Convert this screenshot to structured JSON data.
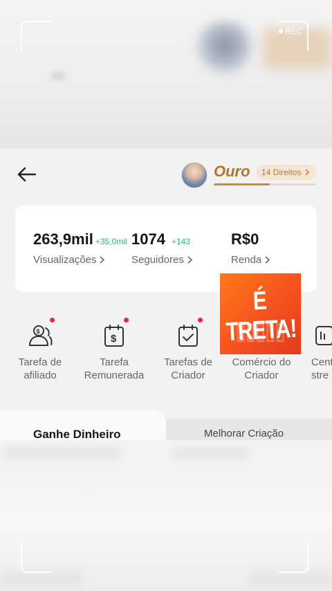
{
  "recording": {
    "label": "REC"
  },
  "header": {
    "level_name": "Ouro",
    "rights_label": "14 Direitos",
    "level_progress": 0.55
  },
  "stats": [
    {
      "value": "263,9mil",
      "delta": "+35,0mil",
      "label": "Visualizações"
    },
    {
      "value": "1074",
      "delta": "+143",
      "label": "Seguidores"
    },
    {
      "value": "R$0",
      "delta": "",
      "label": "Renda"
    }
  ],
  "tools": [
    {
      "label": "Tarefa de afiliado",
      "icon": "affiliate-people-dollar-icon",
      "has_dot": true
    },
    {
      "label": "Tarefa Remunerada",
      "icon": "dollar-calendar-icon",
      "has_dot": true
    },
    {
      "label": "Tarefas de Criador",
      "icon": "calendar-check-icon",
      "has_dot": true
    },
    {
      "label": "Comércio do Criador",
      "icon": "shop-icon",
      "has_dot": false
    },
    {
      "label": "Cent stre",
      "icon": "live-center-icon",
      "has_dot": false
    }
  ],
  "overlay": {
    "text": "É TRETA!"
  },
  "tabs": [
    {
      "label": "Ganhe Dinheiro",
      "active": true
    },
    {
      "label": "Melhorar Criação",
      "active": false
    }
  ],
  "colors": {
    "gold": "#b5762a",
    "delta_green": "#2dbb6a",
    "notification_red": "#e8283c",
    "overlay_orange": "#f5511f"
  }
}
